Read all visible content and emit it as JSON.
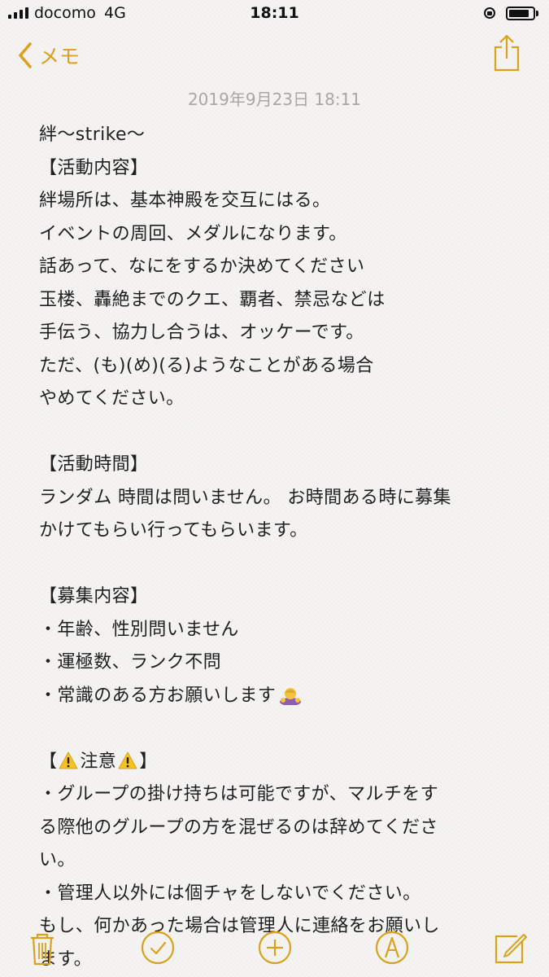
{
  "status_bar": {
    "carrier": "docomo",
    "network": "4G",
    "time": "18:11",
    "battery_level": 0.85
  },
  "nav": {
    "back_label": "メモ",
    "back_icon": "chevron-left-icon",
    "share_icon": "share-icon"
  },
  "note": {
    "date": "2019年9月23日 18:11",
    "lines": [
      "絆〜strike〜",
      "【活動内容】",
      "絆場所は、基本神殿を交互にはる。",
      "イベントの周回、メダルになります。",
      "話あって、なにをするか決めてください",
      "玉楼、轟絶までのクエ、覇者、禁忌などは",
      "手伝う、協力し合うは、オッケーです。",
      "ただ、(も)(め)(る)ようなことがある場合",
      "やめてください。",
      "",
      "【活動時間】",
      "ランダム 時間は問いません。 お時間ある時に募集",
      "かけてもらい行ってもらいます。",
      "",
      "【募集内容】",
      "・年齢、性別問いません",
      "・運極数、ランク不問",
      "・常識のある方お願いします",
      "",
      "【",
      "注意",
      "】",
      "・グループの掛け持ちは可能ですが、マルチをす",
      "る際他のグループの方を混ぜるのは辞めてくださ",
      "い。",
      "・管理人以外には個チャをしないでください。",
      "もし、何かあった場合は管理人に連絡をお願いし",
      "ます。"
    ]
  },
  "toolbar": {
    "icons": [
      "trash-icon",
      "checklist-icon",
      "plus-icon",
      "sketch-icon",
      "compose-icon"
    ]
  },
  "colors": {
    "accent": "#d9a21c",
    "date": "#a9a7a4",
    "text": "#1f1f1f",
    "background": "#f6f5f3"
  }
}
